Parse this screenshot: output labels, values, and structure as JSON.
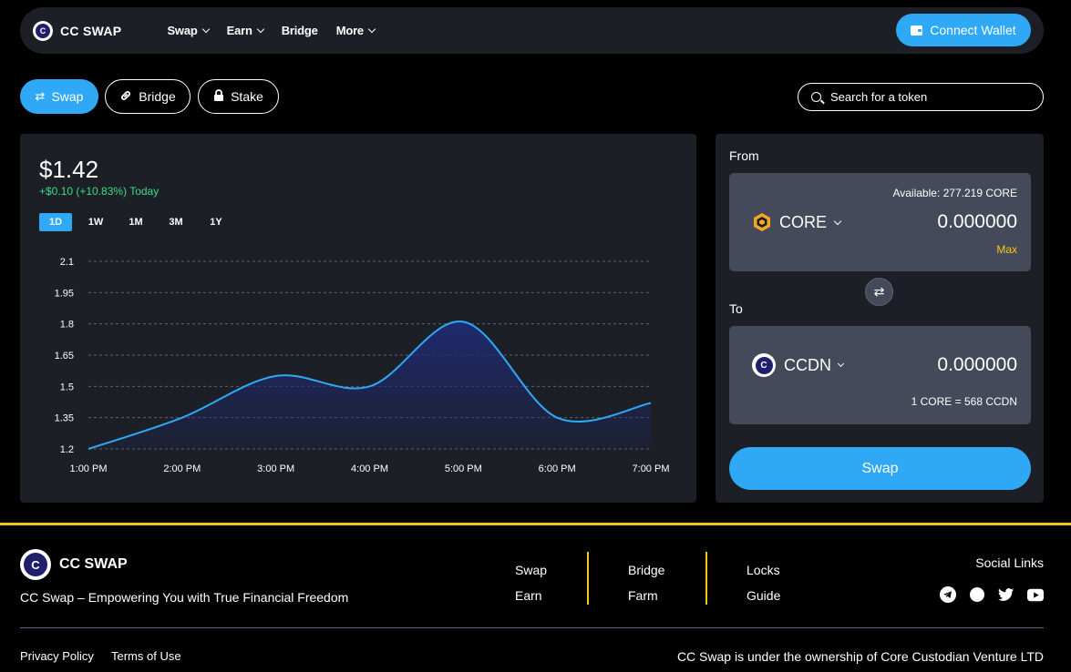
{
  "nav": {
    "brand": "CC SWAP",
    "links": [
      "Swap",
      "Earn",
      "Bridge",
      "More"
    ],
    "connect_label": "Connect Wallet"
  },
  "tabs": {
    "swap": "Swap",
    "bridge": "Bridge",
    "stake": "Stake"
  },
  "search": {
    "placeholder": "Search for a token"
  },
  "price": {
    "value": "$1.42",
    "change": "+$0.10 (+10.83%) Today",
    "ranges": [
      "1D",
      "1W",
      "1M",
      "3M",
      "1Y"
    ],
    "active_range": "1D"
  },
  "chart_data": {
    "type": "area",
    "x": [
      "1:00 PM",
      "2:00 PM",
      "3:00 PM",
      "4:00 PM",
      "5:00 PM",
      "6:00 PM",
      "7:00 PM"
    ],
    "series": [
      {
        "values": [
          1.2,
          1.35,
          1.55,
          1.5,
          1.81,
          1.35,
          1.42
        ]
      }
    ],
    "y_ticks": [
      "2.1",
      "1.95",
      "1.8",
      "1.65",
      "1.5",
      "1.35",
      "1.2"
    ],
    "ylim": [
      1.2,
      2.1
    ],
    "grid": true,
    "line_color": "#2fa8f5",
    "fill_color": "#1e2a6e"
  },
  "swap": {
    "from_label": "From",
    "available": "Available: 277.219 CORE",
    "from_token": "CORE",
    "from_amount": "0.000000",
    "max_label": "Max",
    "to_label": "To",
    "to_token": "CCDN",
    "to_amount": "0.000000",
    "rate": "1 CORE = 568 CCDN",
    "swap_label": "Swap"
  },
  "footer": {
    "brand": "CC SWAP",
    "tagline": "CC Swap – Empowering You with True Financial Freedom",
    "col1": [
      "Swap",
      "Earn"
    ],
    "col2": [
      "Bridge",
      "Farm"
    ],
    "col3": [
      "Locks",
      "Guide"
    ],
    "social_title": "Social Links",
    "privacy": "Privacy Policy",
    "terms": "Terms of Use",
    "ownership": "CC Swap is under the ownership of Core Custodian Venture LTD"
  },
  "colors": {
    "accent": "#2fa8f5",
    "gold": "#f5c518",
    "positive": "#3ddc84",
    "panel": "#1c1f26"
  }
}
